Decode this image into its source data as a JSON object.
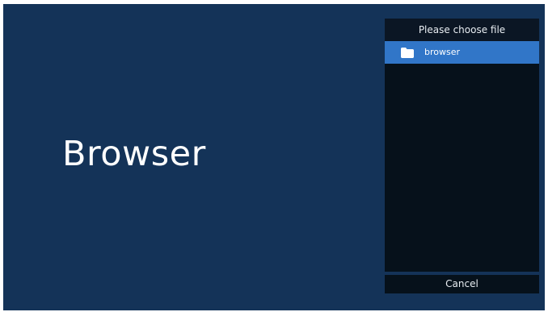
{
  "app": {
    "title": "Browser",
    "background_color": "#143358"
  },
  "file_dialog": {
    "title": "Please choose file",
    "items": [
      {
        "label": "browser",
        "icon": "folder-icon",
        "selected": true,
        "highlight_color": "#3176c8"
      }
    ],
    "cancel_label": "Cancel"
  }
}
